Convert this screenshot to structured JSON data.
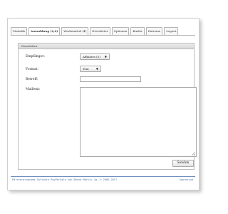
{
  "tabs": [
    {
      "label": "Statistik"
    },
    {
      "label": "Auszahlung (0,0)"
    },
    {
      "label": "Werbemittel (4)"
    },
    {
      "label": "Newsletter"
    },
    {
      "label": "Optionen"
    },
    {
      "label": "Kinder"
    },
    {
      "label": "Extreme"
    },
    {
      "label": "Logout"
    }
  ],
  "active_tab": "Auszahlung (0,0)",
  "panel": {
    "title": "Newsletter"
  },
  "form": {
    "recipient_label": "Empfänger:",
    "recipient_value": "Affiliates (5)",
    "format_label": "Format:",
    "format_value": "Text",
    "subject_label": "Betreff:",
    "subject_value": "",
    "message_label": "Mailtext:",
    "message_value": "",
    "send_label": "Senden"
  },
  "footer": {
    "left_text": "Partnerprogramm Software PayPerSale von Bernd Martin Jg. © 2005-2017",
    "right_text": "Impressum"
  },
  "colors": {
    "footer_accent": "#4a6fa5",
    "border": "#bdbdbd"
  }
}
